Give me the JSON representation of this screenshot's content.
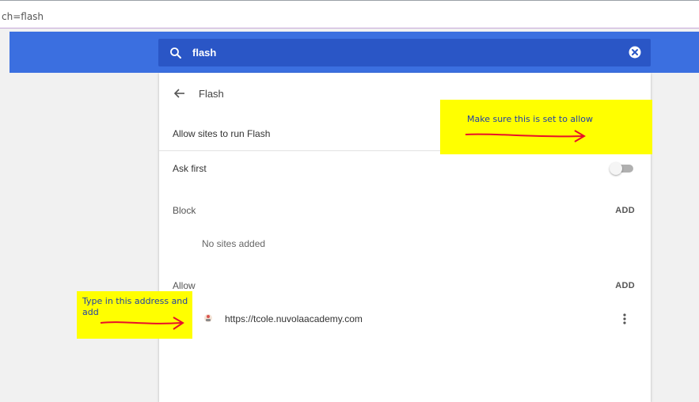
{
  "address_bar": {
    "text": "ch=flash"
  },
  "search": {
    "query": "flash"
  },
  "page": {
    "title": "Flash"
  },
  "settings": {
    "allow_flash": {
      "label": "Allow sites to run Flash",
      "enabled": true
    },
    "ask_first": {
      "label": "Ask first",
      "enabled": false
    }
  },
  "block_section": {
    "label": "Block",
    "add_label": "ADD",
    "empty_text": "No sites added"
  },
  "allow_section": {
    "label": "Allow",
    "add_label": "ADD",
    "sites": [
      {
        "url": "https://tcole.nuvolaacademy.com"
      }
    ]
  },
  "annotations": {
    "toggle_note": "Make sure this is set to allow",
    "address_note_line1": "Type in this address and",
    "address_note_line2": "add"
  },
  "colors": {
    "brand_blue": "#3b6fe0",
    "search_bg": "#2a56c6",
    "toggle_on": "#3b78e7",
    "annotation_bg": "#ffff00",
    "annotation_arrow": "#e8102a"
  },
  "icons": {
    "search": "search-icon",
    "clear": "clear-search-icon",
    "back": "back-arrow-icon",
    "more": "more-vert-icon",
    "favicon": "site-favicon"
  }
}
